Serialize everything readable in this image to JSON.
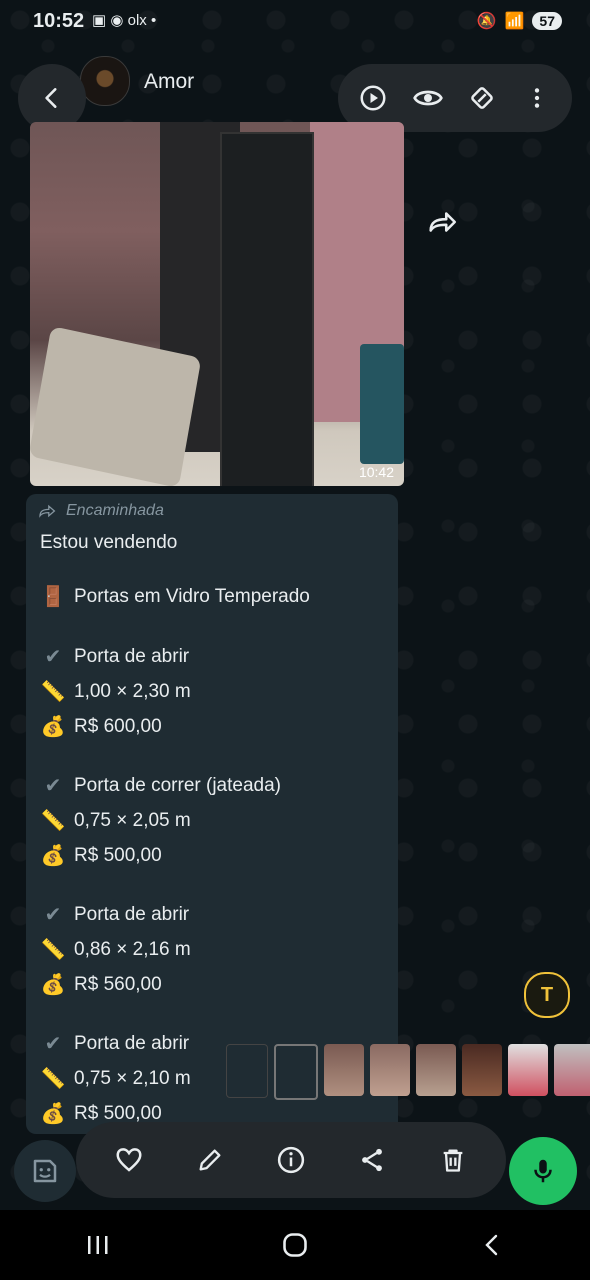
{
  "status_bar": {
    "time": "10:52",
    "left_icons": "▣ ◉ olx •",
    "battery": "57"
  },
  "header": {
    "contact_name": "Amor"
  },
  "photo": {
    "timestamp": "10:42"
  },
  "message": {
    "forwarded_label": "Encaminhada",
    "intro": "Estou vendendo",
    "title": "Portas em Vidro Temperado",
    "items": [
      {
        "name": "Porta de abrir",
        "size": "1,00 × 2,30 m",
        "price": "R$ 600,00"
      },
      {
        "name": "Porta de correr (jateada)",
        "size": "0,75 × 2,05 m",
        "price": "R$ 500,00"
      },
      {
        "name": "Porta de abrir",
        "size": "0,86 × 2,16 m",
        "price": "R$ 560,00"
      },
      {
        "name": "Porta de abrir",
        "size": "0,75 × 2,10 m",
        "price": "R$ 500,00"
      }
    ]
  },
  "colors": {
    "bubble": "#1f2c33",
    "accent_green": "#21c063",
    "text_fab": "#f0c23a"
  },
  "icons": [
    "back-arrow-icon",
    "play-icon",
    "eye-icon",
    "rotate-icon",
    "more-vert-icon",
    "forward-icon",
    "heart-icon",
    "pencil-icon",
    "info-icon",
    "share-icon",
    "trash-icon",
    "mic-icon",
    "sticker-icon",
    "text-icon"
  ]
}
